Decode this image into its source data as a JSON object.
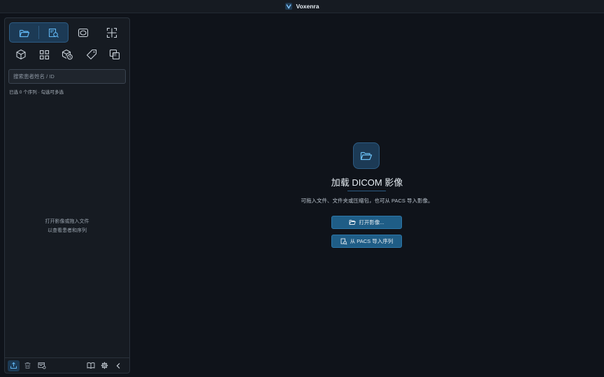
{
  "app": {
    "title": "Voxenra"
  },
  "sidebar": {
    "toolbar_row1": [
      {
        "name": "open-folder-icon",
        "active": true
      },
      {
        "name": "series-search-icon",
        "active": true
      },
      {
        "name": "window-level-icon",
        "active": false
      },
      {
        "name": "crop-frame-icon",
        "active": false
      }
    ],
    "toolbar_row2": [
      {
        "name": "3d-cube-icon"
      },
      {
        "name": "grid-layout-icon"
      },
      {
        "name": "cube-clock-icon"
      },
      {
        "name": "tag-icon"
      },
      {
        "name": "layers-icon"
      }
    ],
    "search": {
      "placeholder": "搜索患者姓名 / ID"
    },
    "selection_status": "已选 0 个序列 · 勾选可多选",
    "empty_hint": {
      "line1": "打开影像或拖入文件",
      "line2": "以查看患者和序列"
    },
    "bottom_bar": [
      "export-icon",
      "trash-icon",
      "import-archive-icon",
      "book-icon",
      "gear-icon",
      "chevron-left-icon"
    ]
  },
  "main": {
    "heading": "加载 DICOM 影像",
    "description": "可拖入文件、文件夹或压缩包，也可从 PACS 导入影像。",
    "open_button": "打开影像...",
    "pacs_button": "从 PACS 导入序列"
  },
  "colors": {
    "accent": "#1f5d86",
    "background": "#0f131a",
    "panel": "#161b22"
  }
}
